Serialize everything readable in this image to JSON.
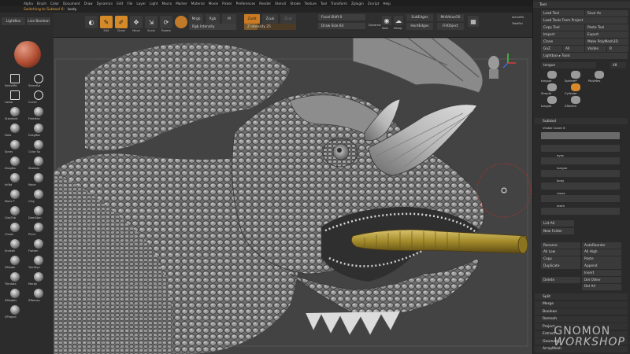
{
  "menu": [
    "Alpha",
    "Brush",
    "Color",
    "Document",
    "Draw",
    "Dynamics",
    "Edit",
    "File",
    "Layer",
    "Light",
    "Macro",
    "Marker",
    "Material",
    "Movie",
    "Picker",
    "Preferences",
    "Render",
    "Stencil",
    "Stroke",
    "Texture",
    "Tool",
    "Transform",
    "Zplugin",
    "Zscript",
    "Help"
  ],
  "status": {
    "message": "Switching to Subtool 6:",
    "tool": "body"
  },
  "shelf": {
    "lightbox": "LightBox",
    "live_boolean": "Live Boolean",
    "edit": "Edit",
    "draw": "Draw",
    "move": "Move",
    "scale": "Scale",
    "rotate": "Rotate",
    "mrgb": "Mrgb",
    "rgb": "Rgb",
    "m": "M",
    "zadd": "Zadd",
    "zsub": "Zsub",
    "zcut": "Zcut",
    "rgb_intensity": "Rgb Intensity",
    "z_intensity": "Z Intensity 25",
    "z_intensity_value": 25,
    "focal_shift": "Focal Shift 0",
    "draw_size": "Draw Size 64",
    "dynamic": "Dynamic",
    "active_points": "ActivePo",
    "total_points": "TotalPoi",
    "solo": "Solo",
    "setup": "Setup",
    "sub_edges": "SubEdges",
    "hard_edges": "HardEdges",
    "mid_value": "MidValue50",
    "fill_object": "FillObject"
  },
  "left": {
    "tabs": [
      "LightBox",
      "Live Boolean"
    ],
    "tools": [
      {
        "label": "SelectRe",
        "icon": "select-rect-icon"
      },
      {
        "label": "SelectLa",
        "icon": "select-lasso-icon"
      },
      {
        "label": "Lasso",
        "icon": "lasso-icon"
      },
      {
        "label": "Curve",
        "icon": "curve-icon"
      },
      {
        "label": "Standard",
        "icon": "standard-brush-icon"
      },
      {
        "label": "FreeHan",
        "icon": "freehand-stroke-icon"
      },
      {
        "label": "Dots",
        "icon": "dots-stroke-icon"
      },
      {
        "label": "DragRec",
        "icon": "dragrect-stroke-icon"
      },
      {
        "label": "Spray",
        "icon": "spray-stroke-icon"
      },
      {
        "label": "Color Sp",
        "icon": "color-spray-icon"
      },
      {
        "label": "DragDo",
        "icon": "dragdot-icon"
      },
      {
        "label": "Standar",
        "icon": "standard-brush-icon"
      },
      {
        "label": "Inflat",
        "icon": "inflate-brush-icon"
      },
      {
        "label": "Move",
        "icon": "move-brush-icon"
      },
      {
        "label": "Move T",
        "icon": "move-topo-brush-icon"
      },
      {
        "label": "Clay",
        "icon": "clay-brush-icon"
      },
      {
        "label": "ClayTub",
        "icon": "claytubes-brush-icon"
      },
      {
        "label": "DamStan",
        "icon": "damstandard-brush-icon"
      },
      {
        "label": "Chisel",
        "icon": "chisel-brush-icon"
      },
      {
        "label": "Pinch",
        "icon": "pinch-brush-icon"
      },
      {
        "label": "Snakeh",
        "icon": "snakehook-brush-icon"
      },
      {
        "label": "Flatten",
        "icon": "flatten-brush-icon"
      },
      {
        "label": "ZModel",
        "icon": "zmodeler-brush-icon"
      },
      {
        "label": "TrimDyn",
        "icon": "trimdynamic-brush-icon"
      },
      {
        "label": "TrimAda",
        "icon": "trimadaptive-brush-icon"
      },
      {
        "label": "Morph",
        "icon": "morph-brush-icon"
      },
      {
        "label": "ZModels",
        "icon": "zmodels-icon"
      },
      {
        "label": "ZRemes",
        "icon": "zremesher-icon"
      },
      {
        "label": "ZProject",
        "icon": "zproject-icon"
      }
    ]
  },
  "right": {
    "title": "Tool",
    "buttons": [
      [
        "Load Tool",
        "Save As"
      ],
      [
        "Load Tools From Project"
      ],
      [
        "Copy Tool",
        "Paste Tool"
      ],
      [
        "Import",
        "Export"
      ],
      [
        "Clone",
        "Make PolyMesh3D"
      ],
      [
        "GoZ",
        "All",
        "Visible",
        "R"
      ],
      [
        "Lightbox ▸ Tools"
      ]
    ],
    "tool_name": "tongue",
    "tool_value": "48",
    "thumbs": [
      "tongue",
      "SphereP",
      "PolyMes",
      "Simple",
      "Cylinder",
      "tongue",
      "ZSketch"
    ],
    "subtool_title": "Subtool",
    "visible_count": "Visible Count 6",
    "subtools": [
      "",
      "",
      "eyes",
      "tongue",
      "body",
      "claws",
      "teeth"
    ],
    "list_all": "List All",
    "new_folder": "New Folder",
    "actions": [
      [
        "Rename",
        "AutoReorder"
      ],
      [
        "All Low",
        "All High"
      ],
      [
        "Copy",
        "Paste"
      ],
      [
        "Duplicate",
        "Append"
      ],
      [
        "",
        "Insert"
      ],
      [
        "Delete",
        "Del Other"
      ],
      [
        "",
        "Del All"
      ]
    ],
    "sections": [
      "Split",
      "Merge",
      "Boolean",
      "Remesh",
      "Project",
      "Extract",
      "Geometry",
      "ArrayMesh"
    ]
  },
  "watermark": {
    "line1": "GNOMON",
    "line2": "WORKSHOP"
  }
}
